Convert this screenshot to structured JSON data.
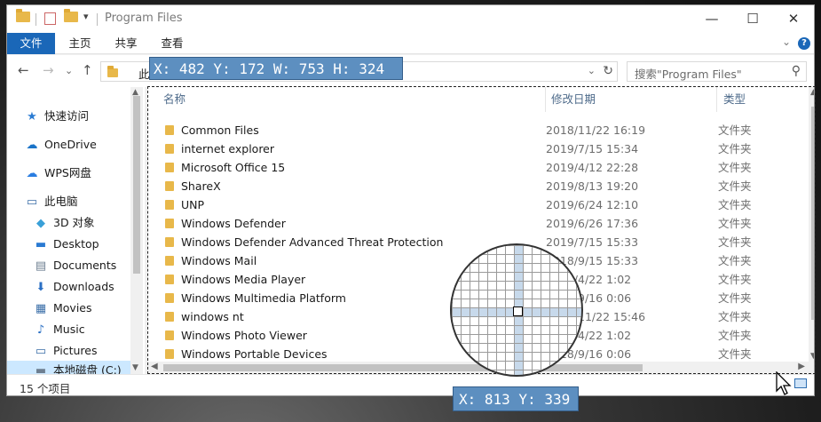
{
  "window": {
    "title": "Program Files",
    "qa_dropdown": "▾",
    "controls": {
      "minimize": "—",
      "maximize": "☐",
      "close": "✕"
    }
  },
  "ribbon": {
    "tabs": [
      "文件",
      "主页",
      "共享",
      "查看"
    ],
    "collapse": "⌄",
    "help": "?"
  },
  "nav": {
    "address_text": "此",
    "address_dropdown": "⌄",
    "refresh": "↻",
    "search_placeholder": "搜索\"Program Files\""
  },
  "sidebar": {
    "items": [
      {
        "label": "快速访问",
        "icon": "star-icon",
        "glyph": "★",
        "color": "#2b7cd3"
      },
      {
        "label": "OneDrive",
        "icon": "cloud-icon",
        "glyph": "☁",
        "color": "#1a73c8"
      },
      {
        "label": "WPS网盘",
        "icon": "cloud-outline-icon",
        "glyph": "☁",
        "color": "#2a7de1"
      },
      {
        "label": "此电脑",
        "icon": "computer-icon",
        "glyph": "▭",
        "color": "#3a6ea8"
      },
      {
        "label": "3D 对象",
        "icon": "cube-icon",
        "glyph": "◆",
        "color": "#3aa0d8"
      },
      {
        "label": "Desktop",
        "icon": "desktop-icon",
        "glyph": "▬",
        "color": "#2a7ad2"
      },
      {
        "label": "Documents",
        "icon": "document-icon",
        "glyph": "▤",
        "color": "#6e7f91"
      },
      {
        "label": "Downloads",
        "icon": "download-icon",
        "glyph": "⬇",
        "color": "#2a6fc4"
      },
      {
        "label": "Movies",
        "icon": "film-icon",
        "glyph": "▦",
        "color": "#3a6ea8"
      },
      {
        "label": "Music",
        "icon": "music-icon",
        "glyph": "♪",
        "color": "#2a6fc4"
      },
      {
        "label": "Pictures",
        "icon": "picture-icon",
        "glyph": "▭",
        "color": "#3a6ea8"
      },
      {
        "label": "本地磁盘 (C:)",
        "icon": "drive-icon",
        "glyph": "▬",
        "color": "#6e7f91"
      }
    ]
  },
  "columns": {
    "name": "名称",
    "date": "修改日期",
    "type": "类型"
  },
  "files": [
    {
      "name": "Common Files",
      "date": "2018/11/22 16:19",
      "type": "文件夹"
    },
    {
      "name": "internet explorer",
      "date": "2019/7/15 15:34",
      "type": "文件夹"
    },
    {
      "name": "Microsoft Office 15",
      "date": "2019/4/12 22:28",
      "type": "文件夹"
    },
    {
      "name": "ShareX",
      "date": "2019/8/13 19:20",
      "type": "文件夹"
    },
    {
      "name": "UNP",
      "date": "2019/6/24 12:10",
      "type": "文件夹"
    },
    {
      "name": "Windows Defender",
      "date": "2019/6/26 17:36",
      "type": "文件夹"
    },
    {
      "name": "Windows Defender Advanced Threat Protection",
      "date": "2019/7/15 15:33",
      "type": "文件夹"
    },
    {
      "name": "Windows Mail",
      "date": "2018/9/15 15:33",
      "type": "文件夹"
    },
    {
      "name": "Windows Media Player",
      "date": "2019/4/22 1:02",
      "type": "文件夹"
    },
    {
      "name": "Windows Multimedia Platform",
      "date": "2018/9/16 0:06",
      "type": "文件夹"
    },
    {
      "name": "windows nt",
      "date": "2018/11/22 15:46",
      "type": "文件夹"
    },
    {
      "name": "Windows Photo Viewer",
      "date": "2019/4/22 1:02",
      "type": "文件夹"
    },
    {
      "name": "Windows Portable Devices",
      "date": "2018/9/16 0:06",
      "type": "文件夹"
    }
  ],
  "status": {
    "item_count": "15 个项目"
  },
  "capture": {
    "region_readout": "X: 482 Y: 172 W: 753 H: 324",
    "cursor_readout": "X: 813 Y: 339"
  }
}
